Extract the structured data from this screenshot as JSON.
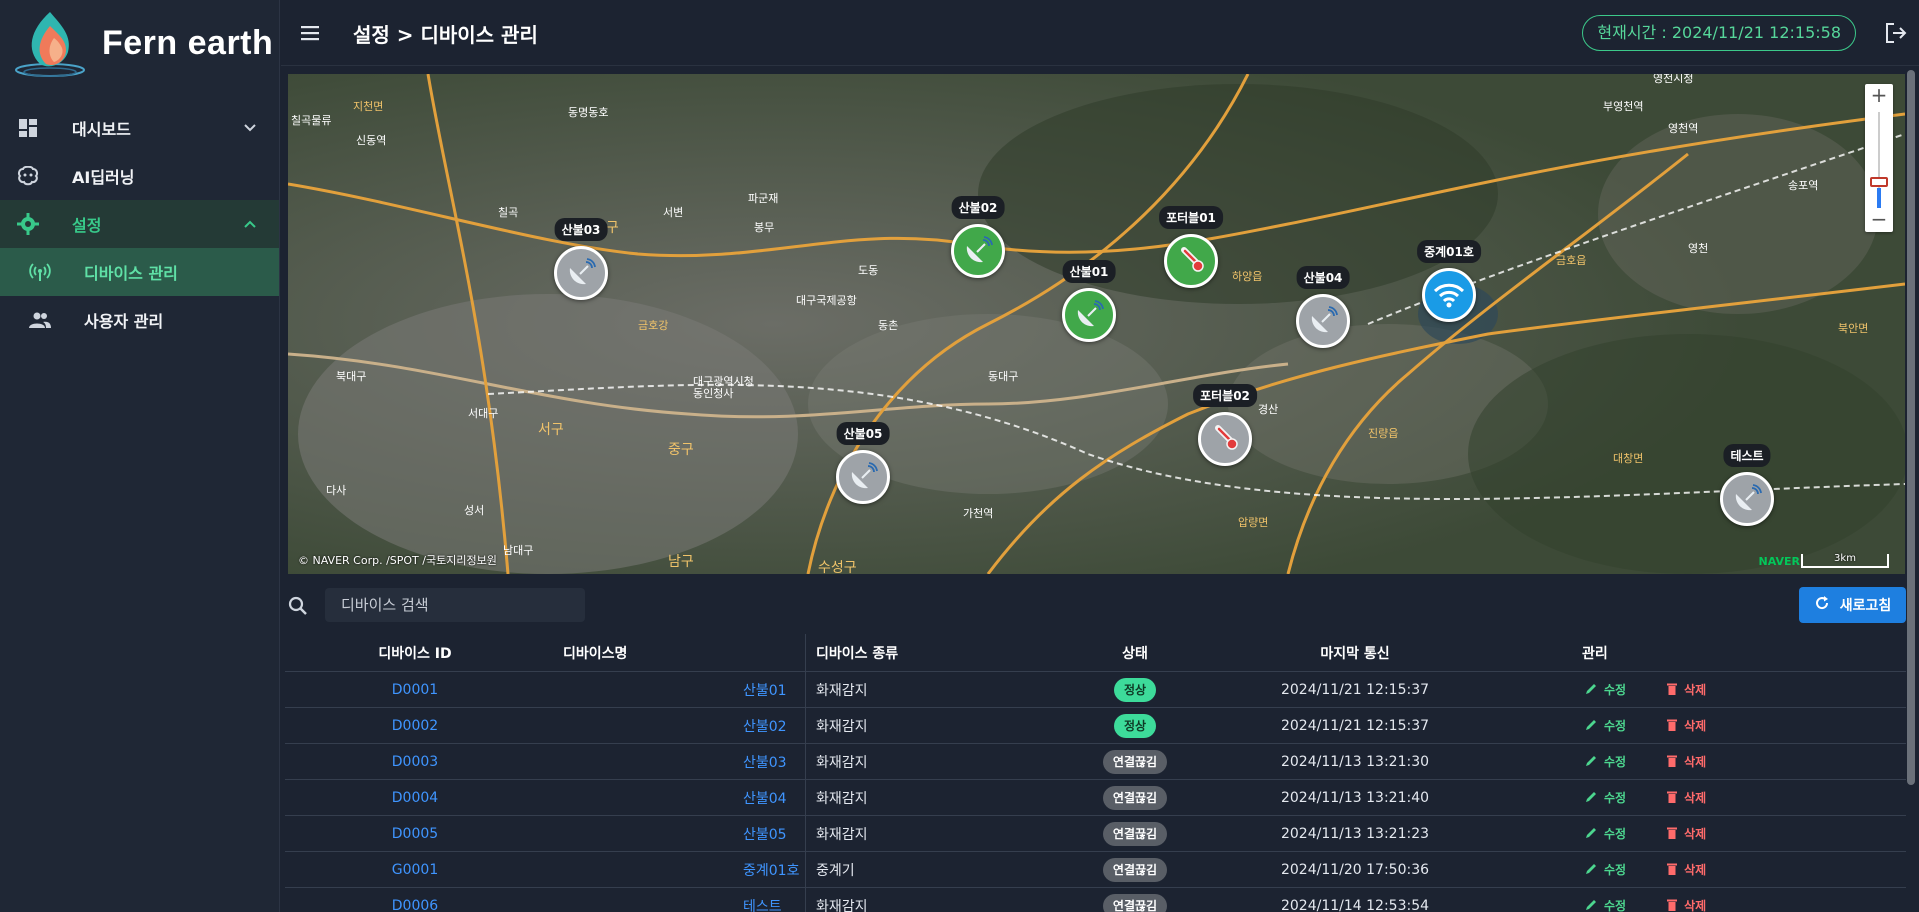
{
  "brand": {
    "name": "Fern earth"
  },
  "sidebar": {
    "items": [
      {
        "label": "대시보드",
        "icon": "dashboard-icon"
      },
      {
        "label": "AI딥러닝",
        "icon": "brain-icon"
      },
      {
        "label": "설정",
        "icon": "gear-icon"
      }
    ],
    "sub_items": [
      {
        "label": "디바이스 관리",
        "icon": "antenna-icon"
      },
      {
        "label": "사용자 관리",
        "icon": "users-icon"
      }
    ]
  },
  "header": {
    "breadcrumb": "설정 > 디바이스 관리",
    "clock": "현재시간 : 2024/11/21 12:15:58"
  },
  "map": {
    "copyright": "© NAVER Corp. /SPOT /국토지리정보원",
    "naver": "NAVER",
    "scale": "3km",
    "zoom_in": "+",
    "zoom_out": "−",
    "markers": [
      {
        "label": "산불03",
        "type": "sensor",
        "color": "gray"
      },
      {
        "label": "산불02",
        "type": "sensor",
        "color": "green"
      },
      {
        "label": "산불01",
        "type": "sensor",
        "color": "green"
      },
      {
        "label": "포터블01",
        "type": "thermometer",
        "color": "green"
      },
      {
        "label": "산불04",
        "type": "sensor",
        "color": "gray"
      },
      {
        "label": "중계01호",
        "type": "wifi",
        "color": "blue"
      },
      {
        "label": "포터블02",
        "type": "thermometer",
        "color": "gray"
      },
      {
        "label": "산불05",
        "type": "sensor",
        "color": "gray"
      },
      {
        "label": "테스트",
        "type": "sensor",
        "color": "gray"
      }
    ],
    "places": [
      "칠곡물류",
      "지천면",
      "동명동호",
      "신동역",
      "칠곡",
      "서변",
      "파군재",
      "북구",
      "봉무",
      "동",
      "금호강",
      "대구국제공항",
      "동촌",
      "도동",
      "동대구",
      "대구광역시청 동인청사",
      "중구",
      "서구",
      "북대구",
      "서대구",
      "다사",
      "성서",
      "남대구",
      "남구",
      "수성구",
      "가천역",
      "하양읍",
      "경산",
      "압량면",
      "진량읍",
      "금호읍",
      "영천",
      "북안면",
      "대창면",
      "영천역",
      "부영천역",
      "영천시청",
      "송포역"
    ]
  },
  "search": {
    "placeholder": "디바이스 검색"
  },
  "refresh_label": "새로고침",
  "table": {
    "headers": {
      "id": "디바이스 ID",
      "name": "디바이스명",
      "type": "디바이스 종류",
      "status": "상태",
      "last": "마지막 통신",
      "manage": "관리"
    },
    "edit_label": "수정",
    "delete_label": "삭제",
    "rows": [
      {
        "id": "D0001",
        "name": "산불01",
        "type": "화재감지",
        "status": "정상",
        "last": "2024/11/21 12:15:37"
      },
      {
        "id": "D0002",
        "name": "산불02",
        "type": "화재감지",
        "status": "정상",
        "last": "2024/11/21 12:15:37"
      },
      {
        "id": "D0003",
        "name": "산불03",
        "type": "화재감지",
        "status": "연결끊김",
        "last": "2024/11/13 13:21:30"
      },
      {
        "id": "D0004",
        "name": "산불04",
        "type": "화재감지",
        "status": "연결끊김",
        "last": "2024/11/13 13:21:40"
      },
      {
        "id": "D0005",
        "name": "산불05",
        "type": "화재감지",
        "status": "연결끊김",
        "last": "2024/11/13 13:21:23"
      },
      {
        "id": "G0001",
        "name": "중계01호",
        "type": "중계기",
        "status": "연결끊김",
        "last": "2024/11/20 17:50:36"
      },
      {
        "id": "D0006",
        "name": "테스트",
        "type": "화재감지",
        "status": "연결끊김",
        "last": "2024/11/14 12:53:54"
      }
    ]
  },
  "colors": {
    "accent": "#3cc98a",
    "link": "#3f95ff",
    "ok": "#3ddb9a",
    "offline": "#595e66",
    "delete": "#ff6b6b",
    "primary": "#1e7fe0"
  }
}
